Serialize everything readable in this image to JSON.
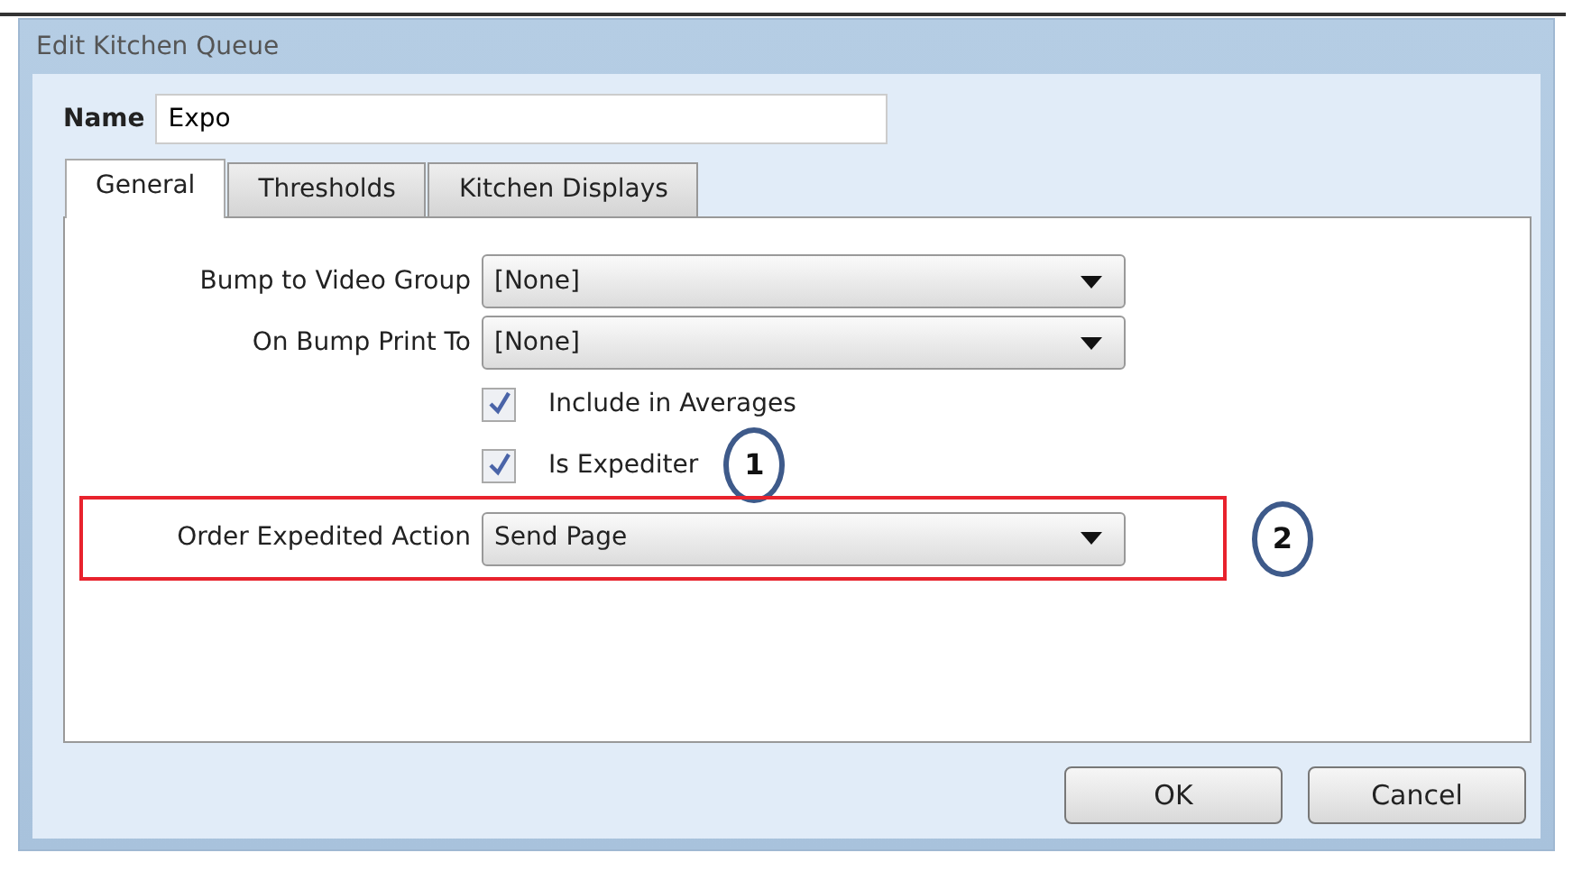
{
  "window": {
    "title": "Edit Kitchen Queue"
  },
  "name_field": {
    "label": "Name",
    "value": "Expo"
  },
  "tabs": [
    {
      "label": "General",
      "selected": true
    },
    {
      "label": "Thresholds",
      "selected": false
    },
    {
      "label": "Kitchen Displays",
      "selected": false
    }
  ],
  "fields": [
    {
      "kind": "dropdown",
      "label": "Bump to Video Group",
      "value": "[None]",
      "highlighted": false
    },
    {
      "kind": "dropdown",
      "label": "On Bump Print To",
      "value": "[None]",
      "highlighted": false
    },
    {
      "kind": "checkbox",
      "label": "Include in Averages",
      "checked": true
    },
    {
      "kind": "checkbox",
      "label": "Is Expediter",
      "checked": true,
      "callout": "1"
    },
    {
      "kind": "dropdown",
      "label": "Order Expedited Action",
      "value": "Send Page",
      "highlighted": true,
      "callout": "2"
    }
  ],
  "buttons": [
    "OK",
    "Cancel"
  ]
}
